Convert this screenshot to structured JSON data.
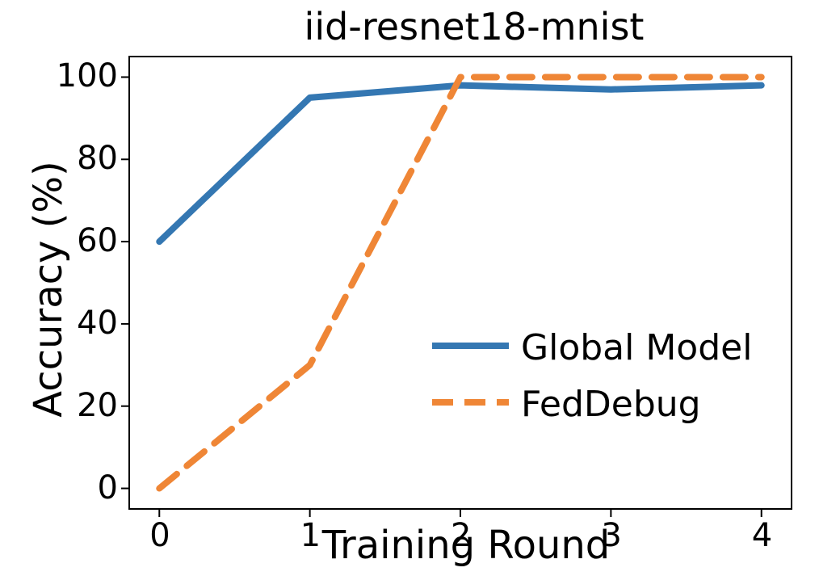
{
  "chart_data": {
    "type": "line",
    "title": "iid-resnet18-mnist",
    "xlabel": "Training Round",
    "ylabel": "Accuracy (%)",
    "xlim": [
      -0.2,
      4.2
    ],
    "ylim": [
      -5,
      105
    ],
    "x": [
      0,
      1,
      2,
      3,
      4
    ],
    "xticklabels": [
      "0",
      "1",
      "2",
      "3",
      "4"
    ],
    "yticks": [
      0,
      20,
      40,
      60,
      80,
      100
    ],
    "yticklabels": [
      "0",
      "20",
      "40",
      "60",
      "80",
      "100"
    ],
    "series": [
      {
        "name": "Global Model",
        "color": "#3477b2",
        "style": "solid",
        "values": [
          60,
          95,
          98,
          97,
          98
        ]
      },
      {
        "name": "FedDebug",
        "color": "#ef8636",
        "style": "dashed",
        "values": [
          0,
          30,
          100,
          100,
          100
        ]
      }
    ],
    "legend_position": "lower-right"
  }
}
